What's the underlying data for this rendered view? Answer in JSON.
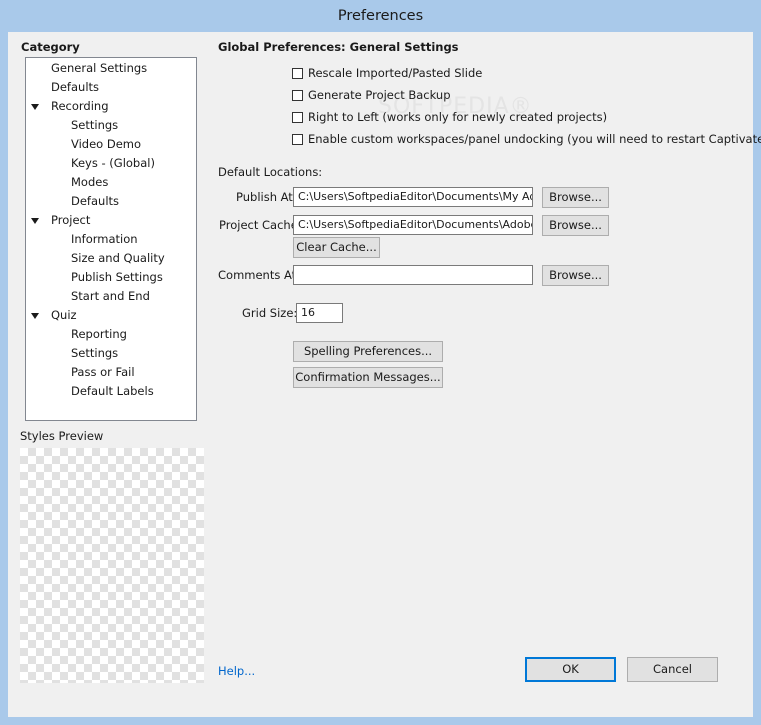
{
  "window": {
    "title": "Preferences"
  },
  "category": {
    "title": "Category",
    "items": [
      {
        "label": "General Settings",
        "level": 1,
        "expandable": false
      },
      {
        "label": "Defaults",
        "level": 1,
        "expandable": false
      },
      {
        "label": "Recording",
        "level": 1,
        "expandable": true
      },
      {
        "label": "Settings",
        "level": 2,
        "expandable": false
      },
      {
        "label": "Video Demo",
        "level": 2,
        "expandable": false
      },
      {
        "label": "Keys - (Global)",
        "level": 2,
        "expandable": false
      },
      {
        "label": "Modes",
        "level": 2,
        "expandable": false
      },
      {
        "label": "Defaults",
        "level": 2,
        "expandable": false
      },
      {
        "label": "Project",
        "level": 1,
        "expandable": true
      },
      {
        "label": "Information",
        "level": 2,
        "expandable": false
      },
      {
        "label": "Size and Quality",
        "level": 2,
        "expandable": false
      },
      {
        "label": "Publish Settings",
        "level": 2,
        "expandable": false
      },
      {
        "label": "Start and End",
        "level": 2,
        "expandable": false
      },
      {
        "label": "Quiz",
        "level": 1,
        "expandable": true
      },
      {
        "label": "Reporting",
        "level": 2,
        "expandable": false
      },
      {
        "label": "Settings",
        "level": 2,
        "expandable": false
      },
      {
        "label": "Pass or Fail",
        "level": 2,
        "expandable": false
      },
      {
        "label": "Default Labels",
        "level": 2,
        "expandable": false
      }
    ]
  },
  "styles_preview": {
    "label": "Styles Preview"
  },
  "panel": {
    "title": "Global Preferences: General Settings",
    "checkboxes": [
      {
        "label": "Rescale Imported/Pasted Slide",
        "checked": false
      },
      {
        "label": "Generate Project Backup",
        "checked": false
      },
      {
        "label": "Right to Left (works only for newly created projects)",
        "checked": false
      },
      {
        "label": "Enable custom workspaces/panel undocking (you will need to restart Captivate)",
        "checked": false
      }
    ],
    "watermark": "SOFTPEDIA®",
    "default_locations_label": "Default Locations:",
    "publish_at": {
      "label": "Publish At:",
      "value": "C:\\Users\\SoftpediaEditor\\Documents\\My Adobe",
      "browse": "Browse..."
    },
    "project_cache": {
      "label": "Project Cache:",
      "value": "C:\\Users\\SoftpediaEditor\\Documents\\Adobe Cap",
      "browse": "Browse..."
    },
    "clear_cache": "Clear Cache...",
    "comments_at": {
      "label": "Comments At:",
      "value": "",
      "browse": "Browse..."
    },
    "grid_size": {
      "label": "Grid Size:",
      "value": "16"
    },
    "spelling_button": "Spelling Preferences...",
    "confirmation_button": "Confirmation Messages..."
  },
  "footer": {
    "help": "Help...",
    "ok": "OK",
    "cancel": "Cancel"
  }
}
